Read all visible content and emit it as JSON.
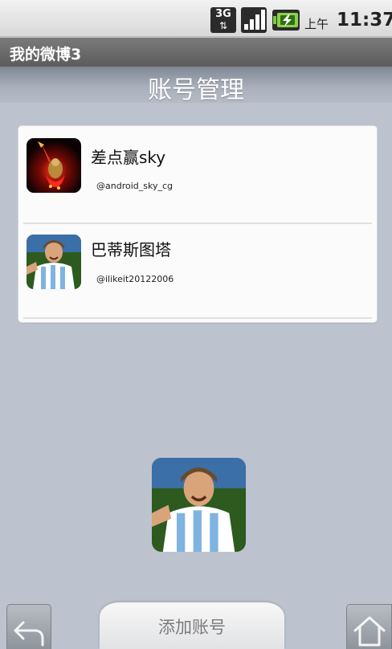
{
  "status_bar": {
    "network_label": "3G",
    "network_icon": "3g-data-icon",
    "signal_icon": "signal-strength-icon",
    "battery_icon": "battery-charging-icon",
    "ampm": "上午",
    "time": "11:37"
  },
  "app": {
    "title": "我的微博3"
  },
  "header": {
    "title": "账号管理"
  },
  "accounts": [
    {
      "name": "差点赢sky",
      "handle": "@android_sky_cg",
      "avatar_icon": "avatar-image"
    },
    {
      "name": "巴蒂斯图塔",
      "handle": "@ilikeit20122006",
      "avatar_icon": "avatar-image"
    }
  ],
  "bottom_bar": {
    "back_icon": "back-arrow-icon",
    "add_account_label": "添加账号",
    "home_icon": "home-icon"
  },
  "colors": {
    "background": "#bcc2ce",
    "card": "#fbfbfb",
    "header_top": "#7f8794",
    "title_bar": "#666666"
  }
}
